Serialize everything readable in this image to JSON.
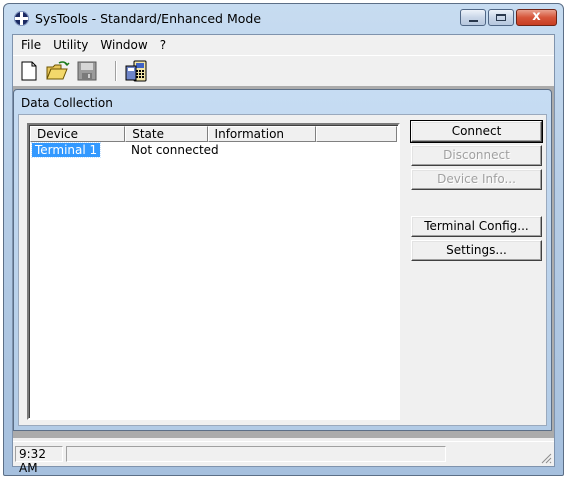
{
  "window": {
    "title": "SysTools - Standard/Enhanced Mode",
    "close_glyph": "x"
  },
  "menu": [
    "File",
    "Utility",
    "Window",
    "?"
  ],
  "toolbar": {
    "icons": [
      "new-document-icon",
      "open-folder-icon",
      "save-disk-icon",
      "terminal-config-icon"
    ]
  },
  "child_window": {
    "title": "Data Collection",
    "list": {
      "columns": [
        "Device",
        "State",
        "Information",
        ""
      ],
      "rows": [
        {
          "device": "Terminal 1",
          "state": "Not connected",
          "information": ""
        }
      ]
    },
    "buttons": {
      "connect": "Connect",
      "disconnect": "Disconnect",
      "device_info": "Device Info...",
      "terminal_config": "Terminal Config...",
      "settings": "Settings..."
    }
  },
  "status_bar": {
    "time": "9:32 AM",
    "message": ""
  },
  "colors": {
    "selection": "#3399ff",
    "mdi_background": "#ababab",
    "close_button": "#d6553a"
  }
}
